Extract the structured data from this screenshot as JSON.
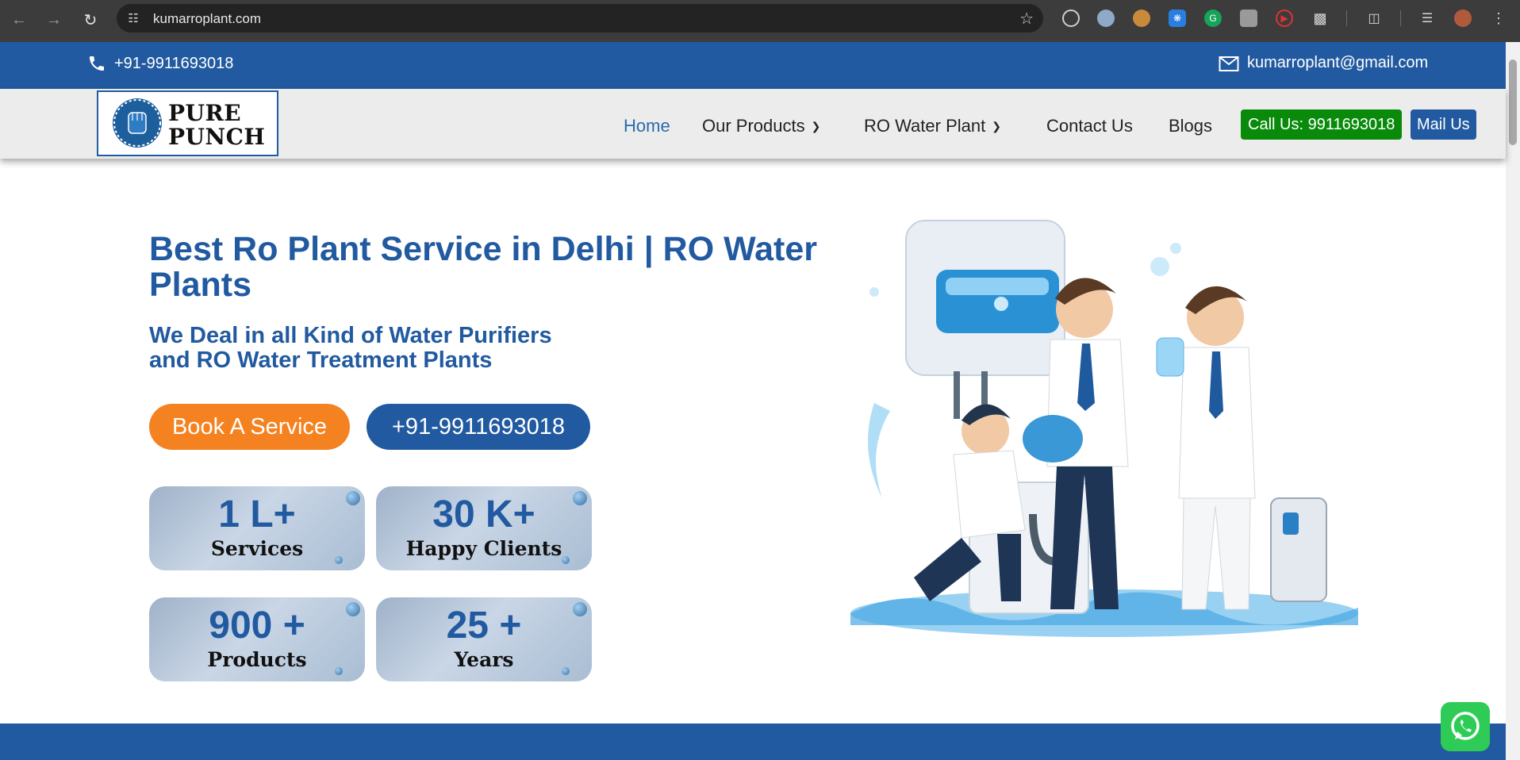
{
  "browser": {
    "url": "kumarroplant.com"
  },
  "topbar": {
    "phone": "+91-9911693018",
    "email": "kumarroplant@gmail.com"
  },
  "logo": {
    "line1": "PURE",
    "line2": "PUNCH"
  },
  "nav": {
    "items": [
      {
        "label": "Home"
      },
      {
        "label": "Our Products"
      },
      {
        "label": "RO Water Plant"
      },
      {
        "label": "Contact Us"
      },
      {
        "label": "Blogs"
      }
    ],
    "call_button": "Call Us: 9911693018",
    "mail_button": "Mail Us"
  },
  "hero": {
    "title": "Best Ro Plant Service in Delhi | RO Water Plants",
    "subtitle": "We Deal in all Kind of Water Purifiers and RO Water Treatment Plants",
    "book_button": "Book A Service",
    "phone_button": "+91-9911693018"
  },
  "stats": [
    {
      "value": "1 L+",
      "label": "Services"
    },
    {
      "value": "30 K+",
      "label": "Happy Clients"
    },
    {
      "value": "900 +",
      "label": "Products"
    },
    {
      "value": "25 +",
      "label": "Years"
    }
  ],
  "colors": {
    "brand_blue": "#215aa0",
    "accent_orange": "#f58220",
    "call_green": "#0a8a0a"
  }
}
